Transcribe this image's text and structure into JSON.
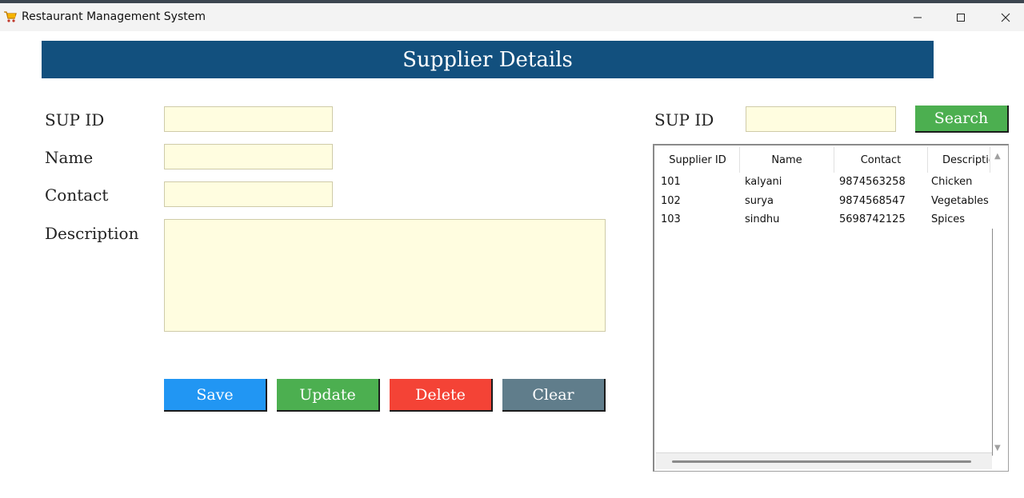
{
  "window": {
    "title": "Restaurant Management System"
  },
  "header": {
    "title": "Supplier Details"
  },
  "form": {
    "sup_id_label": "SUP ID",
    "name_label": "Name",
    "contact_label": "Contact",
    "description_label": "Description",
    "sup_id_value": "",
    "name_value": "",
    "contact_value": "",
    "description_value": ""
  },
  "buttons": {
    "save": "Save",
    "update": "Update",
    "delete": "Delete",
    "clear": "Clear"
  },
  "search": {
    "label": "SUP ID",
    "value": "",
    "button": "Search"
  },
  "table": {
    "columns": [
      "Supplier ID",
      "Name",
      "Contact",
      "Descriptio"
    ],
    "rows": [
      [
        "101",
        "kalyani",
        "9874563258",
        "Chicken"
      ],
      [
        "102",
        "surya",
        "9874568547",
        "Vegetables"
      ],
      [
        "103",
        "sindhu",
        "5698742125",
        "Spices"
      ]
    ]
  },
  "colors": {
    "banner": "#12507e",
    "field_bg": "#fffde0",
    "save": "#2196f3",
    "update": "#4caf50",
    "delete": "#f44336",
    "clear": "#607d8b"
  },
  "icons": {
    "app": "shopping-cart-icon",
    "minimize": "minimize-icon",
    "maximize": "maximize-icon",
    "close": "close-icon"
  }
}
